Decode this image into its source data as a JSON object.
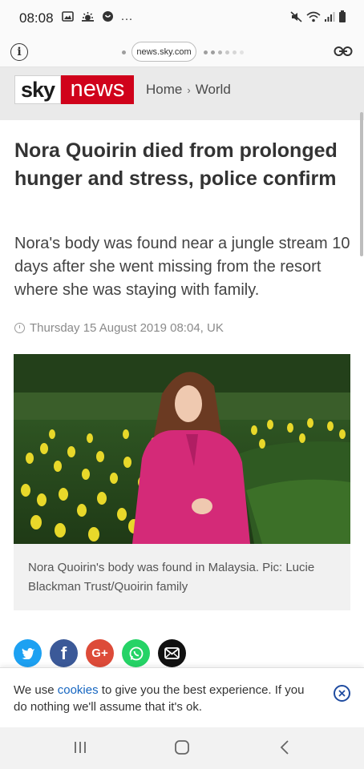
{
  "status_bar": {
    "time": "08:08",
    "more": "···",
    "icons": [
      "gallery-icon",
      "weather-icon",
      "vpn-icon",
      "mute-icon",
      "wifi-icon",
      "signal-icon",
      "battery-icon"
    ]
  },
  "browser": {
    "url": "news.sky.com"
  },
  "header": {
    "logo_sky": "sky",
    "logo_news": "news",
    "breadcrumb": [
      "Home",
      "World"
    ],
    "breadcrumb_separator": "›"
  },
  "article": {
    "headline": "Nora Quoirin died from prolonged hunger and stress, police confirm",
    "standfirst": "Nora's body was found near a jungle stream 10 days after she went missing from the resort where she was staying with family.",
    "timestamp": "Thursday 15 August 2019 08:04, UK",
    "caption": "Nora Quoirin's body was found in Malaysia. Pic: Lucie Blackman Trust/Quoirin family"
  },
  "share": [
    {
      "name": "twitter",
      "glyph": "t",
      "color": "#1da1f2"
    },
    {
      "name": "facebook",
      "glyph": "f",
      "color": "#3b5998"
    },
    {
      "name": "google-plus",
      "glyph": "G+",
      "color": "#dd4b39"
    },
    {
      "name": "whatsapp",
      "glyph": "✆",
      "color": "#25d366"
    },
    {
      "name": "email",
      "glyph": "✉",
      "color": "#111111"
    }
  ],
  "cookie": {
    "text_before": "We use ",
    "link": "cookies",
    "text_after": " to give you the best experience. If you do nothing we'll assume that it's ok."
  },
  "colors": {
    "sky_red": "#d0021b",
    "link_blue": "#1565c0"
  }
}
